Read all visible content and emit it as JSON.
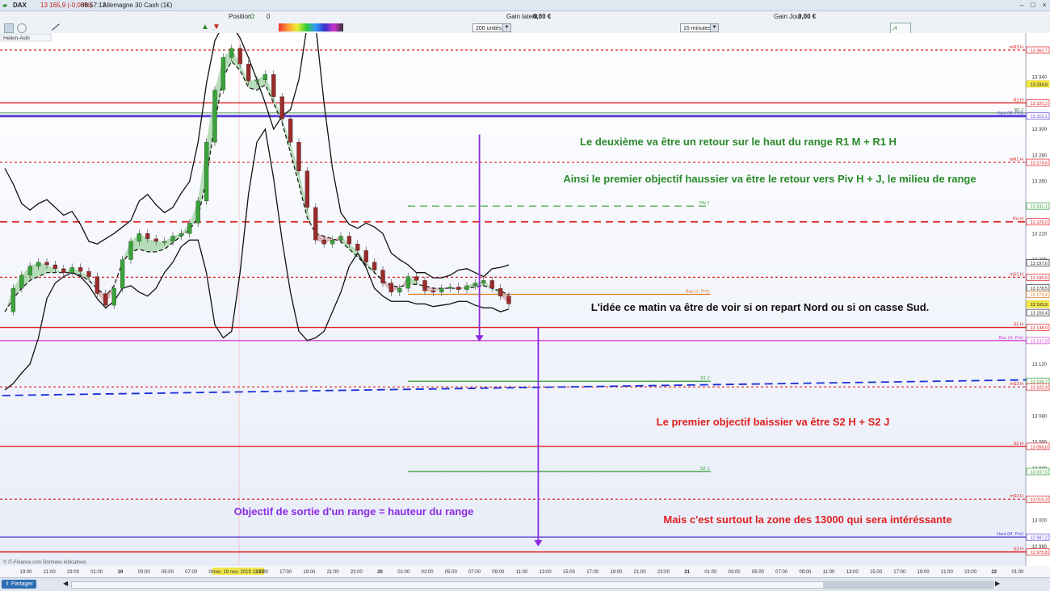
{
  "window": {
    "instrument": "DAX",
    "price_change": "13 165,9 (-0,08%)",
    "time": "08:57:12",
    "instrument_name": "Allemagne 30 Cash (1€)",
    "icons": [
      "chart-icon",
      "minimize-icon",
      "maximize-icon",
      "close-icon"
    ]
  },
  "toolbar": {
    "position_label": "Position :",
    "position_value": "0",
    "position_value2": "0",
    "gain_latent_label": "Gain latent :",
    "gain_latent_value": "0,00 €",
    "gain_jour_label": "Gain Jour :",
    "gain_jour_value": "0,00 €",
    "units_select": "200 unités",
    "timeframe_select": "15 minutes",
    "chart_type_label": "Heikin-Ashi"
  },
  "chart_data": {
    "type": "line",
    "candle_style": "Heikin-Ashi",
    "instrument": "DAX",
    "timeframe": "15 minutes",
    "ylim": [
      12970,
      13370
    ],
    "x_ticks": [
      "19:00",
      "21:00",
      "23:00",
      "01:00",
      "19",
      "03:00",
      "05:00",
      "07:00",
      "09:00",
      "mer. 19 nov. 2019 11:45",
      "15:00",
      "17:00",
      "19:00",
      "21:00",
      "23:00",
      "20",
      "01:00",
      "03:00",
      "05:00",
      "07:00",
      "09:00",
      "11:00",
      "13:00",
      "15:00",
      "17:00",
      "19:00",
      "21:00",
      "23:00",
      "21",
      "01:00",
      "03:00",
      "05:00",
      "07:00",
      "09:00",
      "11:00",
      "13:00",
      "15:00",
      "17:00",
      "19:00",
      "21:00",
      "23:00",
      "22",
      "01:00"
    ],
    "y_ticks": [
      "13 340",
      "13 300",
      "13 280",
      "13 260",
      "13 220",
      "13 200",
      "13 160",
      "13 120",
      "13 080",
      "13 060",
      "13 040",
      "13 000",
      "12 980"
    ],
    "price_axis_labels": [
      {
        "label": "13 360,7",
        "value": 13360.7,
        "color": "#e02020"
      },
      {
        "label": "13 334,8",
        "value": 13334.8,
        "color": "#e6d200"
      },
      {
        "label": "13 320,2",
        "value": 13320.2,
        "color": "#e02020"
      },
      {
        "label": "13 310,1",
        "value": 13310.1,
        "color": "#5a3fd6"
      },
      {
        "label": "13 274,6",
        "value": 13274.6,
        "color": "#e02020"
      },
      {
        "label": "13 241,1",
        "value": 13241.1,
        "color": "#2a9a2a"
      },
      {
        "label": "13 229,0",
        "value": 13229.0,
        "color": "#e02020"
      },
      {
        "label": "13 197,6",
        "value": 13197.6,
        "color": "#222222"
      },
      {
        "label": "13 186,5",
        "value": 13186.5,
        "color": "#e02020"
      },
      {
        "label": "13 178,5",
        "value": 13178.5,
        "color": "#222222"
      },
      {
        "label": "13 173,4",
        "value": 13173.4,
        "color": "#e07a20"
      },
      {
        "label": "13 165,9",
        "value": 13165.9,
        "color": "#e6d200"
      },
      {
        "label": "13 159,4",
        "value": 13159.4,
        "color": "#222222"
      },
      {
        "label": "13 148,0",
        "value": 13148.0,
        "color": "#e02020"
      },
      {
        "label": "13 137,9",
        "value": 13137.9,
        "color": "#d63fd6"
      },
      {
        "label": "13 106,7",
        "value": 13106.7,
        "color": "#2a9a2a"
      },
      {
        "label": "13 102,4",
        "value": 13102.4,
        "color": "#e02020"
      },
      {
        "label": "13 056,8",
        "value": 13056.8,
        "color": "#e02020"
      },
      {
        "label": "13 037,5",
        "value": 13037.5,
        "color": "#2a9a2a"
      },
      {
        "label": "13 016,3",
        "value": 13016.3,
        "color": "#e02020"
      },
      {
        "label": "12 987,2",
        "value": 12987.2,
        "color": "#5a3fd6"
      },
      {
        "label": "12 975,8",
        "value": 12975.8,
        "color": "#e02020"
      }
    ],
    "levels": [
      {
        "name": "mR3 H",
        "value": 13360.7,
        "color": "#e02020",
        "style": "dotted"
      },
      {
        "name": "R1 H",
        "value": 13320.2,
        "color": "#e02020",
        "style": "solid"
      },
      {
        "name": "R1 J",
        "value": 13312.5,
        "color": "#1a7a1a",
        "style": "thin"
      },
      {
        "name": "Haut (M. Pré)",
        "value": 13310.1,
        "color": "#5a3fd6",
        "style": "solid-thick"
      },
      {
        "name": "mR1 H",
        "value": 13274.6,
        "color": "#e02020",
        "style": "dotted"
      },
      {
        "name": "Piv J",
        "value": 13241.1,
        "color": "#2a9a2a",
        "style": "dashed"
      },
      {
        "name": "Piv H",
        "value": 13229.0,
        "color": "#e02020",
        "style": "dashed"
      },
      {
        "name": "mS1 H",
        "value": 13186.5,
        "color": "#e02020",
        "style": "dotted"
      },
      {
        "name": "Bas (J. Pré)",
        "value": 13173.4,
        "color": "#e07a20",
        "style": "solid"
      },
      {
        "name": "S1 H",
        "value": 13148.0,
        "color": "#e02020",
        "style": "solid"
      },
      {
        "name": "Bas (H. Pré)",
        "value": 13137.9,
        "color": "#d63fd6",
        "style": "solid"
      },
      {
        "name": "S1 J",
        "value": 13106.7,
        "color": "#2a9a2a",
        "style": "solid"
      },
      {
        "name": "mS2 H",
        "value": 13102.4,
        "color": "#e02020",
        "style": "dotted"
      },
      {
        "name": "S2 H",
        "value": 13056.8,
        "color": "#e02020",
        "style": "solid"
      },
      {
        "name": "S2 J",
        "value": 13037.5,
        "color": "#2a9a2a",
        "style": "solid"
      },
      {
        "name": "mS3 H",
        "value": 13016.3,
        "color": "#e02020",
        "style": "dotted"
      },
      {
        "name": "Haut (M. Pré)",
        "value": 12987.2,
        "color": "#5a3fd6",
        "style": "solid"
      },
      {
        "name": "S3 H",
        "value": 12975.8,
        "color": "#e02020",
        "style": "solid"
      }
    ],
    "price_series": [
      [
        0,
        13160
      ],
      [
        1,
        13178
      ],
      [
        2,
        13188
      ],
      [
        3,
        13195
      ],
      [
        4,
        13198
      ],
      [
        5,
        13196
      ],
      [
        6,
        13193
      ],
      [
        7,
        13190
      ],
      [
        8,
        13194
      ],
      [
        9,
        13191
      ],
      [
        10,
        13187
      ],
      [
        11,
        13174
      ],
      [
        12,
        13165
      ],
      [
        13,
        13178
      ],
      [
        14,
        13200
      ],
      [
        15,
        13214
      ],
      [
        16,
        13220
      ],
      [
        17,
        13216
      ],
      [
        18,
        13214
      ],
      [
        19,
        13214
      ],
      [
        20,
        13218
      ],
      [
        21,
        13220
      ],
      [
        22,
        13228
      ],
      [
        23,
        13245
      ],
      [
        24,
        13290
      ],
      [
        25,
        13330
      ],
      [
        26,
        13355
      ],
      [
        27,
        13362
      ],
      [
        28,
        13350
      ],
      [
        29,
        13337
      ],
      [
        30,
        13338
      ],
      [
        31,
        13342
      ],
      [
        32,
        13325
      ],
      [
        33,
        13308
      ],
      [
        34,
        13290
      ],
      [
        35,
        13268
      ],
      [
        36,
        13240
      ],
      [
        37,
        13215
      ],
      [
        38,
        13212
      ],
      [
        39,
        13215
      ],
      [
        40,
        13218
      ],
      [
        41,
        13212
      ],
      [
        42,
        13207
      ],
      [
        43,
        13198
      ],
      [
        44,
        13192
      ],
      [
        45,
        13182
      ],
      [
        46,
        13175
      ],
      [
        47,
        13178
      ],
      [
        48,
        13187
      ],
      [
        49,
        13184
      ],
      [
        50,
        13176
      ],
      [
        51,
        13175
      ],
      [
        52,
        13178
      ],
      [
        53,
        13179
      ],
      [
        54,
        13177
      ],
      [
        55,
        13180
      ],
      [
        56,
        13182
      ],
      [
        57,
        13184
      ],
      [
        58,
        13178
      ],
      [
        59,
        13172
      ],
      [
        60,
        13166
      ]
    ],
    "bollinger_upper": [
      [
        0,
        13270
      ],
      [
        1,
        13258
      ],
      [
        2,
        13243
      ],
      [
        3,
        13238
      ],
      [
        4,
        13243
      ],
      [
        5,
        13246
      ],
      [
        6,
        13240
      ],
      [
        7,
        13234
      ],
      [
        8,
        13237
      ],
      [
        9,
        13227
      ],
      [
        10,
        13214
      ],
      [
        11,
        13212
      ],
      [
        12,
        13216
      ],
      [
        13,
        13220
      ],
      [
        14,
        13225
      ],
      [
        15,
        13230
      ],
      [
        16,
        13245
      ],
      [
        17,
        13250
      ],
      [
        18,
        13242
      ],
      [
        19,
        13236
      ],
      [
        20,
        13240
      ],
      [
        21,
        13251
      ],
      [
        22,
        13260
      ],
      [
        23,
        13290
      ],
      [
        24,
        13335
      ],
      [
        25,
        13368
      ],
      [
        26,
        13380
      ],
      [
        27,
        13380
      ],
      [
        28,
        13370
      ],
      [
        29,
        13355
      ],
      [
        30,
        13338
      ],
      [
        31,
        13320
      ],
      [
        32,
        13300
      ],
      [
        33,
        13310
      ],
      [
        34,
        13315
      ],
      [
        35,
        13338
      ],
      [
        36,
        13380
      ],
      [
        37,
        13380
      ],
      [
        38,
        13320
      ],
      [
        39,
        13270
      ],
      [
        40,
        13236
      ],
      [
        41,
        13227
      ],
      [
        42,
        13224
      ],
      [
        43,
        13228
      ],
      [
        44,
        13225
      ],
      [
        45,
        13220
      ],
      [
        46,
        13205
      ],
      [
        47,
        13200
      ],
      [
        48,
        13196
      ],
      [
        49,
        13190
      ],
      [
        50,
        13190
      ],
      [
        51,
        13186
      ],
      [
        52,
        13186
      ],
      [
        53,
        13188
      ],
      [
        54,
        13192
      ],
      [
        55,
        13193
      ],
      [
        56,
        13190
      ],
      [
        57,
        13187
      ],
      [
        58,
        13193
      ],
      [
        59,
        13194
      ],
      [
        60,
        13196
      ]
    ],
    "bollinger_lower": [
      [
        0,
        13100
      ],
      [
        1,
        13105
      ],
      [
        2,
        13113
      ],
      [
        3,
        13120
      ],
      [
        4,
        13140
      ],
      [
        5,
        13170
      ],
      [
        6,
        13182
      ],
      [
        7,
        13187
      ],
      [
        8,
        13190
      ],
      [
        9,
        13187
      ],
      [
        10,
        13180
      ],
      [
        11,
        13170
      ],
      [
        12,
        13163
      ],
      [
        13,
        13168
      ],
      [
        14,
        13178
      ],
      [
        15,
        13180
      ],
      [
        16,
        13175
      ],
      [
        17,
        13172
      ],
      [
        18,
        13178
      ],
      [
        19,
        13190
      ],
      [
        20,
        13198
      ],
      [
        21,
        13210
      ],
      [
        22,
        13215
      ],
      [
        23,
        13215
      ],
      [
        24,
        13190
      ],
      [
        25,
        13150
      ],
      [
        26,
        13140
      ],
      [
        27,
        13145
      ],
      [
        28,
        13190
      ],
      [
        29,
        13250
      ],
      [
        30,
        13290
      ],
      [
        31,
        13300
      ],
      [
        32,
        13262
      ],
      [
        33,
        13215
      ],
      [
        34,
        13175
      ],
      [
        35,
        13145
      ],
      [
        36,
        13138
      ],
      [
        37,
        13140
      ],
      [
        38,
        13145
      ],
      [
        39,
        13160
      ],
      [
        40,
        13175
      ],
      [
        41,
        13195
      ],
      [
        42,
        13205
      ],
      [
        43,
        13194
      ],
      [
        44,
        13178
      ],
      [
        45,
        13172
      ],
      [
        46,
        13168
      ],
      [
        47,
        13168
      ],
      [
        48,
        13168
      ],
      [
        49,
        13166
      ],
      [
        50,
        13166
      ],
      [
        51,
        13164
      ],
      [
        52,
        13165
      ],
      [
        53,
        13166
      ],
      [
        54,
        13168
      ],
      [
        55,
        13168
      ],
      [
        56,
        13165
      ],
      [
        57,
        13163
      ],
      [
        58,
        13163
      ],
      [
        59,
        13160
      ],
      [
        60,
        13162
      ]
    ],
    "ma_series": [
      [
        0,
        13160
      ],
      [
        1,
        13170
      ],
      [
        2,
        13178
      ],
      [
        3,
        13184
      ],
      [
        4,
        13187
      ],
      [
        5,
        13190
      ],
      [
        6,
        13190
      ],
      [
        7,
        13190
      ],
      [
        8,
        13190
      ],
      [
        9,
        13188
      ],
      [
        10,
        13184
      ],
      [
        11,
        13178
      ],
      [
        12,
        13172
      ],
      [
        13,
        13180
      ],
      [
        14,
        13198
      ],
      [
        15,
        13206
      ],
      [
        16,
        13208
      ],
      [
        17,
        13206
      ],
      [
        18,
        13206
      ],
      [
        19,
        13208
      ],
      [
        20,
        13213
      ],
      [
        21,
        13218
      ],
      [
        22,
        13223
      ],
      [
        23,
        13232
      ],
      [
        24,
        13262
      ],
      [
        25,
        13305
      ],
      [
        26,
        13340
      ],
      [
        27,
        13352
      ],
      [
        28,
        13345
      ],
      [
        29,
        13332
      ],
      [
        30,
        13330
      ],
      [
        31,
        13334
      ],
      [
        32,
        13320
      ],
      [
        33,
        13305
      ],
      [
        34,
        13282
      ],
      [
        35,
        13258
      ],
      [
        36,
        13232
      ],
      [
        37,
        13220
      ],
      [
        38,
        13218
      ],
      [
        39,
        13216
      ],
      [
        40,
        13214
      ],
      [
        41,
        13208
      ],
      [
        42,
        13202
      ],
      [
        43,
        13196
      ],
      [
        44,
        13190
      ],
      [
        45,
        13184
      ],
      [
        46,
        13180
      ],
      [
        47,
        13179
      ],
      [
        48,
        13181
      ],
      [
        49,
        13181
      ],
      [
        50,
        13180
      ],
      [
        51,
        13178
      ],
      [
        52,
        13178
      ],
      [
        53,
        13178
      ],
      [
        54,
        13178
      ],
      [
        55,
        13178
      ],
      [
        56,
        13179
      ],
      [
        57,
        13180
      ],
      [
        58,
        13178
      ],
      [
        59,
        13176
      ],
      [
        60,
        13173
      ]
    ],
    "trend_line": {
      "start": [
        -8,
        13095
      ],
      "end": [
        124,
        13108
      ],
      "color": "#1a2fd6",
      "style": "dashed"
    },
    "arrows": [
      {
        "from": [
          56.5,
          13296
        ],
        "to": [
          56.5,
          13137
        ],
        "color": "#8a2be2"
      },
      {
        "from": [
          63.5,
          13148
        ],
        "to": [
          63.5,
          12980
        ],
        "color": "#8a2be2"
      }
    ],
    "annotations": [
      {
        "id": "a1",
        "text": "Le deuxième va être un retour sur le haut du range R1 M + R1 H",
        "color": "#2a8a2a"
      },
      {
        "id": "a2",
        "text": "Ainsi le premier objectif haussier va être le retour vers Piv H + J, le milieu de range",
        "color": "#2a8a2a"
      },
      {
        "id": "a3",
        "text": "L'idée ce matin va être de voir si on repart Nord ou si on casse Sud.",
        "color": "#111111"
      },
      {
        "id": "a4",
        "text": "Le premier objectif baissier va être S2 H + S2 J",
        "color": "#e02020"
      },
      {
        "id": "a5",
        "text": "Objectif de sortie d'un range = hauteur du range",
        "color": "#8a2be2"
      },
      {
        "id": "a6",
        "text": "Mais c'est surtout la zone des 13000 qui sera intéréssante",
        "color": "#e02020"
      }
    ],
    "footer_note": "© IT-Finance.com Données indicatives",
    "grid": false,
    "legend": "none"
  },
  "bottombar": {
    "share_label": "Partager"
  }
}
